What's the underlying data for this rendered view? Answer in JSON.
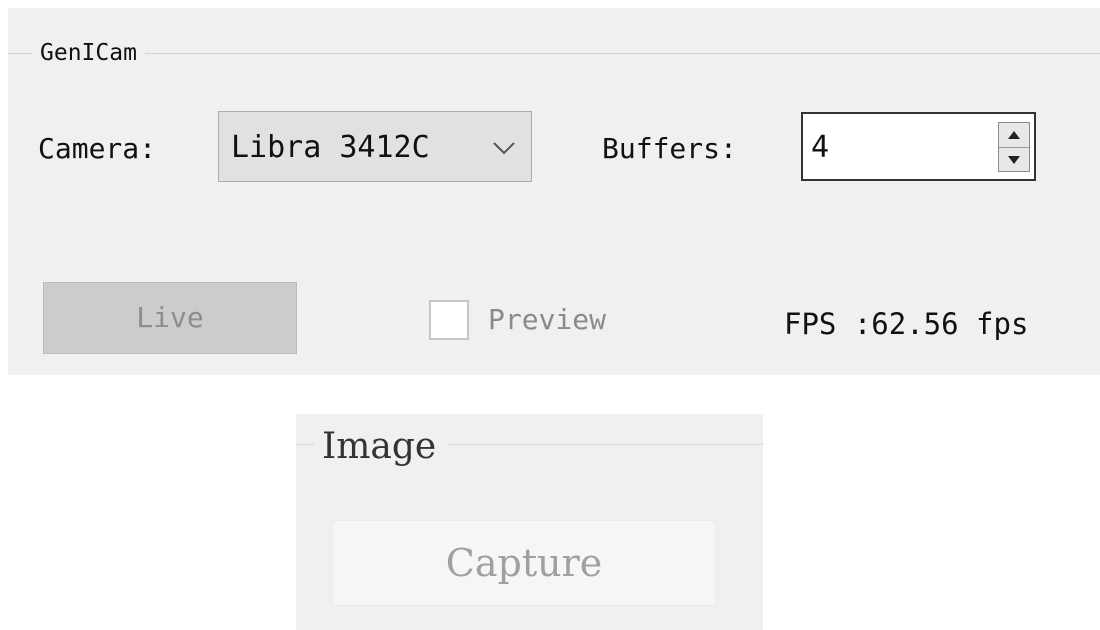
{
  "genicam": {
    "title": "GenICam",
    "camera_label": "Camera:",
    "camera_value": "Libra 3412C",
    "buffers_label": "Buffers:",
    "buffers_value": "4",
    "live_label": "Live",
    "live_enabled": false,
    "preview_label": "Preview",
    "preview_checked": false,
    "preview_enabled": false,
    "fps_text": "FPS :62.56 fps"
  },
  "image": {
    "title": "Image",
    "capture_label": "Capture",
    "capture_enabled": false
  },
  "icons": {
    "combo_arrow": "chevron-down-icon",
    "spin_up": "arrow-up-icon",
    "spin_down": "arrow-down-icon"
  },
  "colors": {
    "panel_background": "#f0f0f0",
    "disabled_button": "#cccccc",
    "disabled_text": "#8d8d8d"
  }
}
